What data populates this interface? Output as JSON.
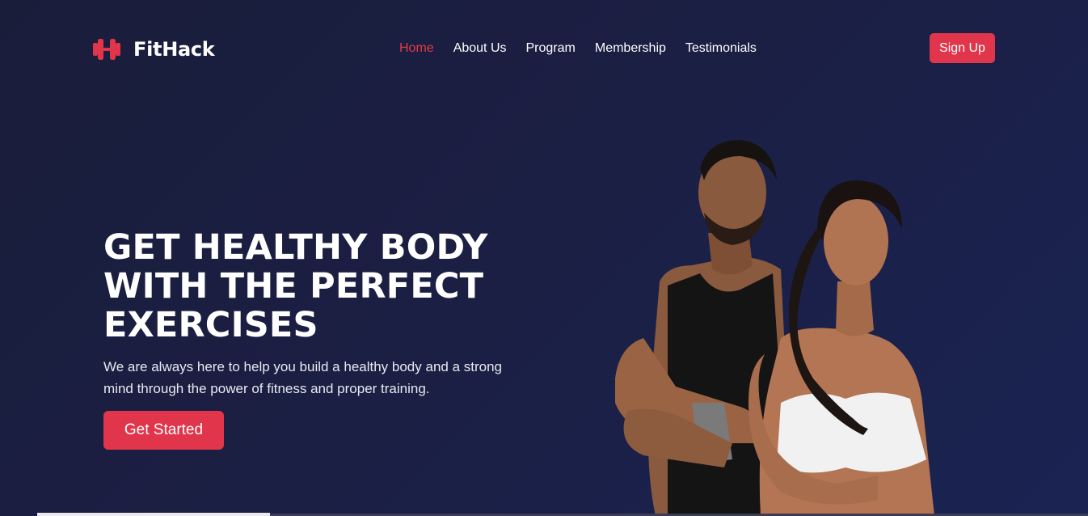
{
  "brand": {
    "name": "FitHack",
    "icon": "dumbbell-icon",
    "accent_color": "#e0354a"
  },
  "nav": {
    "items": [
      {
        "label": "Home",
        "active": true
      },
      {
        "label": "About Us",
        "active": false
      },
      {
        "label": "Program",
        "active": false
      },
      {
        "label": "Membership",
        "active": false
      },
      {
        "label": "Testimonials",
        "active": false
      }
    ]
  },
  "header": {
    "signup_label": "Sign Up"
  },
  "hero": {
    "title": "GET HEALTHY BODY WITH THE PERFECT EXERCISES",
    "description": "We are always here to help you build a healthy body and a strong mind through the power of fitness and proper training.",
    "cta_label": "Get Started"
  },
  "theme": {
    "background": "#1a1d3a",
    "text": "#ffffff"
  }
}
